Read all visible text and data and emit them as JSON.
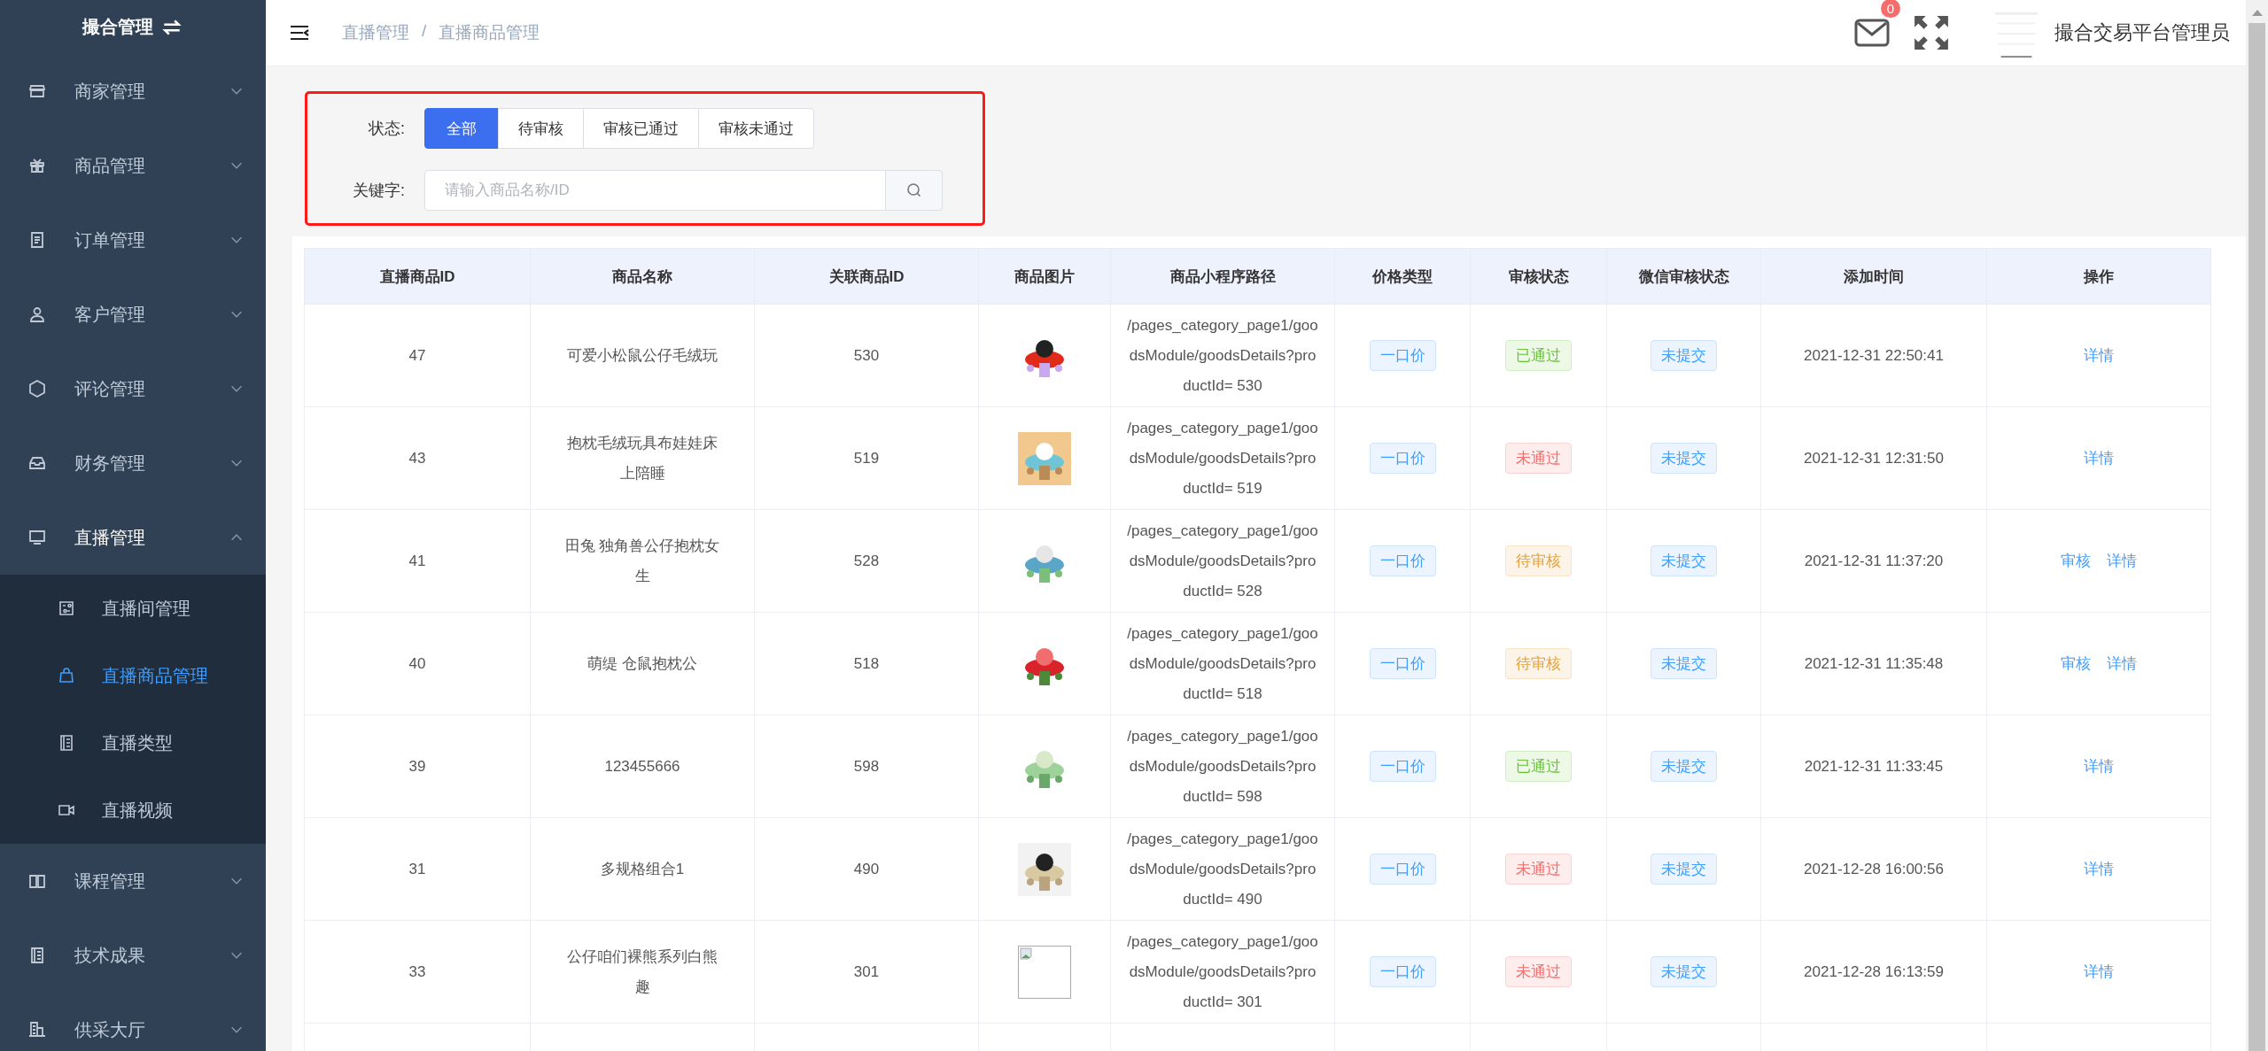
{
  "sidebar": {
    "title": "撮合管理",
    "items": [
      {
        "label": "商家管理",
        "expanded": false
      },
      {
        "label": "商品管理",
        "expanded": false
      },
      {
        "label": "订单管理",
        "expanded": false
      },
      {
        "label": "客户管理",
        "expanded": false
      },
      {
        "label": "评论管理",
        "expanded": false
      },
      {
        "label": "财务管理",
        "expanded": false
      },
      {
        "label": "直播管理",
        "expanded": true,
        "children": [
          {
            "label": "直播间管理",
            "selected": false
          },
          {
            "label": "直播商品管理",
            "selected": true
          },
          {
            "label": "直播类型",
            "selected": false
          },
          {
            "label": "直播视频",
            "selected": false
          }
        ]
      },
      {
        "label": "课程管理",
        "expanded": false
      },
      {
        "label": "技术成果",
        "expanded": false
      },
      {
        "label": "供采大厅",
        "expanded": false
      }
    ]
  },
  "header": {
    "breadcrumb": [
      "直播管理",
      "直播商品管理"
    ],
    "breadcrumb_separator": "/",
    "message_count": "0",
    "user": "撮合交易平台管理员"
  },
  "filter": {
    "status_label": "状态:",
    "status_tabs": [
      {
        "label": "全部",
        "selected": true
      },
      {
        "label": "待审核",
        "selected": false
      },
      {
        "label": "审核已通过",
        "selected": false
      },
      {
        "label": "审核未通过",
        "selected": false
      }
    ],
    "keyword_label": "关键字:",
    "search": {
      "placeholder": "请输入商品名称/ID"
    }
  },
  "table": {
    "columns": [
      "直播商品ID",
      "商品名称",
      "关联商品ID",
      "商品图片",
      "商品小程序路径",
      "价格类型",
      "审核状态",
      "微信审核状态",
      "添加时间",
      "操作"
    ],
    "rows": [
      {
        "id": "47",
        "name": "可爱小松鼠公仔毛绒玩",
        "product_id": "530",
        "image": {
          "kind": "picture"
        },
        "path": "/pages_category_page1/goodsModule/goodsDetails?productId= 530",
        "price_type": "一口价",
        "audit": {
          "label": "已通过",
          "color": "#67c23a"
        },
        "wechat": "未提交",
        "time": "2021-12-31 22:50:41",
        "actions": [
          "详情"
        ]
      },
      {
        "id": "43",
        "name": "抱枕毛绒玩具布娃娃床上陪睡",
        "product_id": "519",
        "image": {
          "kind": "picture"
        },
        "path": "/pages_category_page1/goodsModule/goodsDetails?productId= 519",
        "price_type": "一口价",
        "audit": {
          "label": "未通过",
          "color": "#f56c6c"
        },
        "wechat": "未提交",
        "time": "2021-12-31 12:31:50",
        "actions": [
          "详情"
        ]
      },
      {
        "id": "41",
        "name": "田兔 独角兽公仔抱枕女生",
        "product_id": "528",
        "image": {
          "kind": "picture"
        },
        "path": "/pages_category_page1/goodsModule/goodsDetails?productId= 528",
        "price_type": "一口价",
        "audit": {
          "label": "待审核",
          "color": "#e6a23c"
        },
        "wechat": "未提交",
        "time": "2021-12-31 11:37:20",
        "actions": [
          "审核",
          "详情"
        ]
      },
      {
        "id": "40",
        "name": "萌缇 仓鼠抱枕公",
        "product_id": "518",
        "image": {
          "kind": "picture"
        },
        "path": "/pages_category_page1/goodsModule/goodsDetails?productId= 518",
        "price_type": "一口价",
        "audit": {
          "label": "待审核",
          "color": "#e6a23c"
        },
        "wechat": "未提交",
        "time": "2021-12-31 11:35:48",
        "actions": [
          "审核",
          "详情"
        ]
      },
      {
        "id": "39",
        "name": "123455666",
        "product_id": "598",
        "image": {
          "kind": "picture"
        },
        "path": "/pages_category_page1/goodsModule/goodsDetails?productId= 598",
        "price_type": "一口价",
        "audit": {
          "label": "已通过",
          "color": "#67c23a"
        },
        "wechat": "未提交",
        "time": "2021-12-31 11:33:45",
        "actions": [
          "详情"
        ]
      },
      {
        "id": "31",
        "name": "多规格组合1",
        "product_id": "490",
        "image": {
          "kind": "picture"
        },
        "path": "/pages_category_page1/goodsModule/goodsDetails?productId= 490",
        "price_type": "一口价",
        "audit": {
          "label": "未通过",
          "color": "#f56c6c"
        },
        "wechat": "未提交",
        "time": "2021-12-28 16:00:56",
        "actions": [
          "详情"
        ]
      },
      {
        "id": "33",
        "name": "公仔咱们裸熊系列白熊趣",
        "product_id": "301",
        "image": {
          "kind": "broken"
        },
        "path": "/pages_category_page1/goodsModule/goodsDetails?productId= 301",
        "price_type": "一口价",
        "audit": {
          "label": "未通过",
          "color": "#f56c6c"
        },
        "wechat": "未提交",
        "time": "2021-12-28 16:13:59",
        "actions": [
          "详情"
        ]
      }
    ]
  }
}
